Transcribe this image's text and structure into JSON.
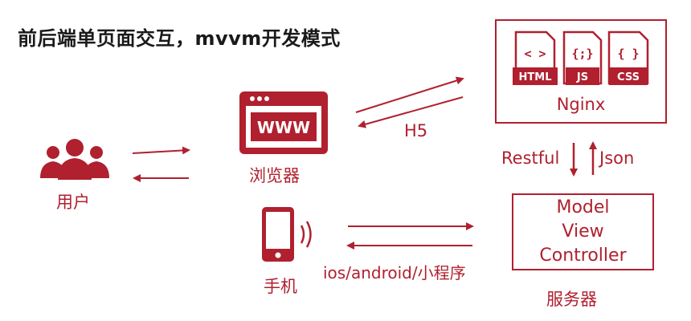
{
  "title": "前后端单页面交互，mvvm开发模式",
  "labels": {
    "user": "用户",
    "browser": "浏览器",
    "phone": "手机",
    "h5": "H5",
    "mobile_clients": "ios/android/小程序",
    "restful": "Restful",
    "json": "Json",
    "server": "服务器"
  },
  "nginx": {
    "name": "Nginx",
    "file_icons": [
      "HTML",
      "JS",
      "CSS"
    ],
    "file_glyphs": [
      "< >",
      "{;}",
      "{ }"
    ]
  },
  "browser_icon_text": "WWW",
  "mvc": {
    "model": "Model",
    "view": "View",
    "controller": "Controller"
  },
  "colors": {
    "accent": "#b0202f",
    "title": "#1a1a1a",
    "background": "#ffffff"
  },
  "icons": [
    "users-icon",
    "browser-www-icon",
    "smartphone-icon",
    "html-file-icon",
    "js-file-icon",
    "css-file-icon"
  ]
}
